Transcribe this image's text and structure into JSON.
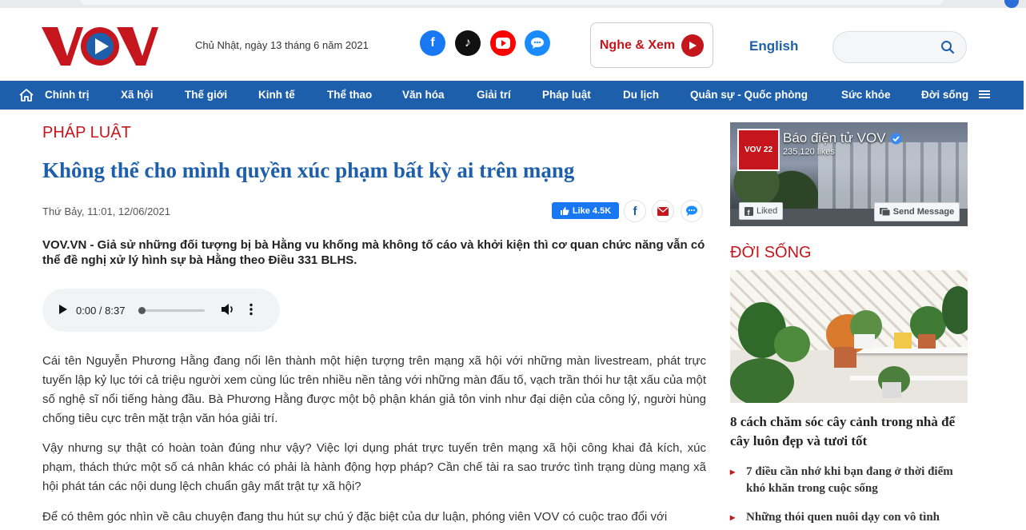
{
  "header": {
    "logo_text": "VOV",
    "date": "Chủ Nhật, ngày 13 tháng 6 năm 2021",
    "social": {
      "facebook": "f",
      "tiktok": "♪",
      "youtube": "▶",
      "zalo": "…"
    },
    "nghe_xem": "Nghe & Xem",
    "english": "English",
    "search_placeholder": ""
  },
  "nav": {
    "items": [
      "Chính trị",
      "Xã hội",
      "Thế giới",
      "Kinh tế",
      "Thể thao",
      "Văn hóa",
      "Giải trí",
      "Pháp luật",
      "Du lịch",
      "Quân sự - Quốc phòng",
      "Sức khỏe",
      "Đời sống"
    ]
  },
  "article": {
    "category": "PHÁP LUẬT",
    "title": "Không thể cho mình quyền xúc phạm bất kỳ ai trên mạng",
    "meta": "Thứ Bảy, 11:01, 12/06/2021",
    "like_label": "Like 4.5K",
    "sapo": "VOV.VN - Giả sử những đối tượng bị bà Hằng vu khống mà không tố cáo và khởi kiện thì cơ quan chức năng vẫn có thể đề nghị xử lý hình sự bà Hằng theo Điều 331 BLHS.",
    "audio_time": "0:00 / 8:37",
    "audio_progress": 0,
    "paragraphs": [
      "Cái tên Nguyễn Phương Hằng đang nổi lên thành một hiện tượng trên mạng xã hội với những màn livestream, phát trực tuyến lập kỷ lục tới cả triệu người xem cùng lúc trên nhiều nền tảng với những màn đấu tố, vạch trần thói hư tật xấu của một số nghệ sĩ nổi tiếng hàng đầu. Bà Phương Hằng được một bộ phận khán giả tôn vinh như đại diện của công lý, người hùng chống tiêu cực trên mặt trận văn hóa giải trí.",
      "Vậy nhưng sự thật có hoàn toàn đúng như vậy? Việc lợi dụng phát trực tuyến trên mạng xã hội công khai đả kích, xúc phạm, thách thức một số cá nhân khác có phải là hành động hợp pháp? Cần chế tài ra sao trước tình trạng dùng mạng xã hội phát tán các nội dung lệch chuẩn gây mất trật tự xã hội?",
      "Để có thêm góc nhìn về câu chuyện đang thu hút sự chú ý đặc biệt của dư luận, phóng viên VOV có cuộc trao đổi với"
    ]
  },
  "sidebar": {
    "fb_page_name": "Báo điện tử VOV",
    "fb_likes": "235,120 likes",
    "fb_liked": "Liked",
    "fb_send": "Send Message",
    "fb_avatar_text": "VOV 22",
    "category": "ĐỜI SỐNG",
    "feature_title": "8 cách chăm sóc cây cảnh trong nhà để cây luôn đẹp và tươi tốt",
    "items": [
      "7 điều cần nhớ khi bạn đang ở thời điểm khó khăn trong cuộc sống",
      "Những thói quen nuôi dạy con vô tình"
    ]
  },
  "colors": {
    "brand_red": "#c4161c",
    "brand_blue": "#1d5faa"
  }
}
